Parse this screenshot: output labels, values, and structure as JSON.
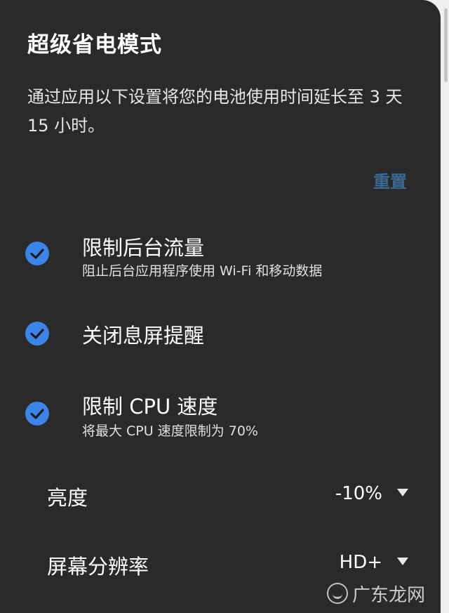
{
  "panel": {
    "title": "超级省电模式",
    "description": "通过应用以下设置将您的电池使用时间延长至 3 天 15 小时。",
    "reset_label": "重置"
  },
  "options": [
    {
      "title": "限制后台流量",
      "subtitle": "阻止后台应用程序使用 Wi-Fi 和移动数据",
      "checked": true
    },
    {
      "title": "关闭息屏提醒",
      "subtitle": "",
      "checked": true
    },
    {
      "title": "限制 CPU 速度",
      "subtitle": "将最大 CPU 速度限制为 70%",
      "checked": true
    }
  ],
  "settings": [
    {
      "label": "亮度",
      "value": "-10%"
    },
    {
      "label": "屏幕分辨率",
      "value": "HD+"
    }
  ],
  "watermark": {
    "text": "广东龙网"
  },
  "colors": {
    "background": "#2a2a2a",
    "accent_check": "#3b84e8",
    "reset_link": "#3b6a96"
  },
  "icons": {
    "check": "check-circle-icon",
    "dropdown": "triangle-down-icon"
  }
}
